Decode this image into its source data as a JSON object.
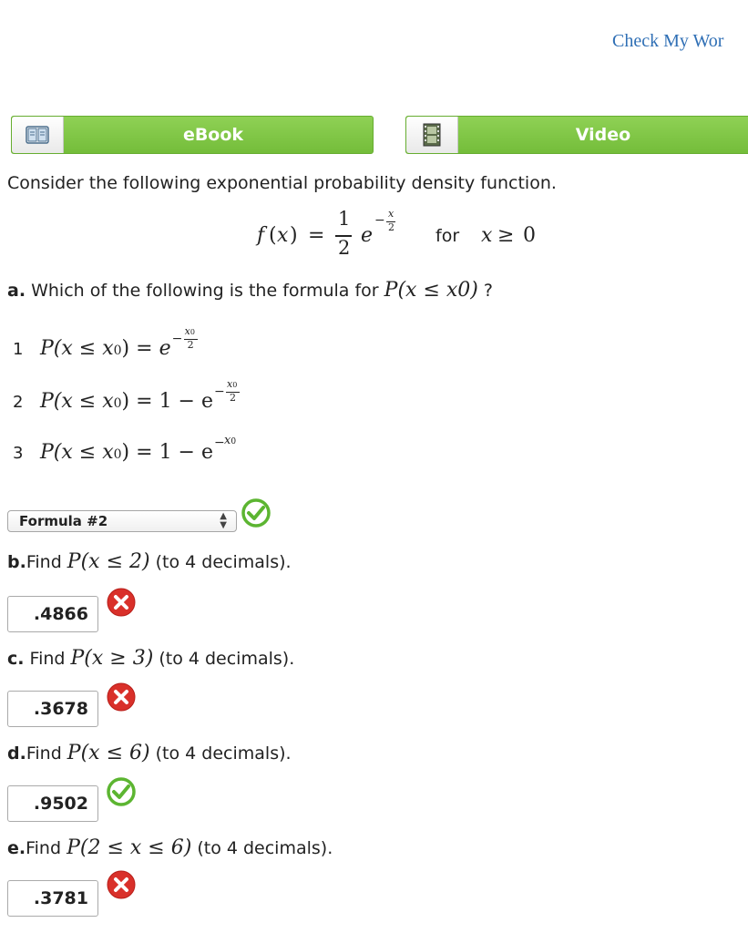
{
  "header": {
    "check_link": "Check My Wor"
  },
  "toolbar": {
    "ebook_label": "eBook",
    "video_label": "Video"
  },
  "intro": "Consider the following exponential probability density function.",
  "pdf": {
    "lhs": "f",
    "arg": "x",
    "frac_num": "1",
    "frac_den": "2",
    "base": "e",
    "exp_num": "x",
    "exp_den": "2",
    "for_word": "for",
    "cond_var": "x",
    "cond_op": "≥",
    "cond_val": "0"
  },
  "part_a": {
    "label": "a.",
    "text": " Which of the following is the formula for ",
    "expr": "P(x ≤ x0)",
    "suffix": " ?",
    "options": [
      {
        "num": "1",
        "lhs": "P(x ≤ x",
        "rhs": "e",
        "exp": "x0/2"
      },
      {
        "num": "2",
        "lhs": "P(x ≤ x",
        "rhs": "1 − e",
        "exp": "x0/2"
      },
      {
        "num": "3",
        "lhs": "P(x ≤ x",
        "rhs": "1 − e",
        "exp": "x0"
      }
    ],
    "selected": "Formula #2",
    "status": "correct"
  },
  "part_b": {
    "label": "b.",
    "text_pre": "Find ",
    "expr": "P(x ≤ 2)",
    "text_post": " (to 4 decimals).",
    "answer": ".4866",
    "status": "incorrect"
  },
  "part_c": {
    "label": "c.",
    "text_pre": " Find ",
    "expr": "P(x ≥ 3)",
    "text_post": " (to 4 decimals).",
    "answer": ".3678",
    "status": "incorrect"
  },
  "part_d": {
    "label": "d.",
    "text_pre": "Find ",
    "expr": "P(x ≤ 6)",
    "text_post": " (to 4 decimals).",
    "answer": ".9502",
    "status": "correct"
  },
  "part_e": {
    "label": "e.",
    "text_pre": "Find ",
    "expr": "P(2 ≤ x ≤ 6)",
    "text_post": " (to 4 decimals).",
    "answer": ".3781",
    "status": "incorrect"
  },
  "colors": {
    "link": "#2f6fb5",
    "button_green": "#7cc243",
    "correct": "#5cb531",
    "incorrect": "#d9302a"
  },
  "icons": {
    "ebook": "book-icon",
    "video": "film-icon",
    "correct": "check-circle-icon",
    "incorrect": "x-circle-icon"
  }
}
